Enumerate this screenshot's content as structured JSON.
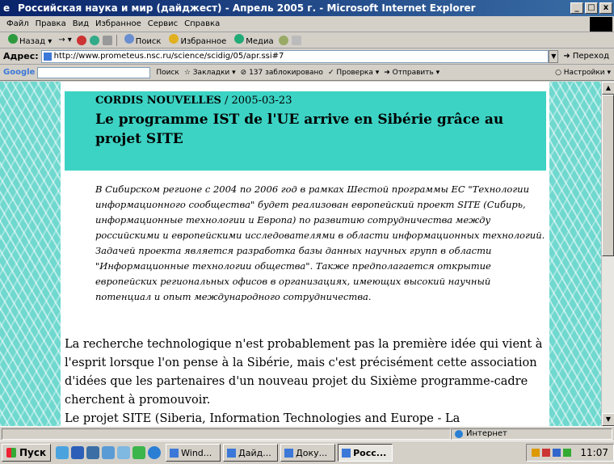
{
  "window": {
    "title": "Российская наука и мир (дайджест) - Апрель 2005 г. - Microsoft Internet Explorer",
    "min_label": "_",
    "max_label": "□",
    "close_label": "x"
  },
  "menu": [
    "Файл",
    "Правка",
    "Вид",
    "Избранное",
    "Сервис",
    "Справка"
  ],
  "toolbar": {
    "back": "Назад",
    "search": "Поиск",
    "favorites": "Избранное",
    "media": "Медиа"
  },
  "address": {
    "label": "Адрес:",
    "url": "http://www.prometeus.nsc.ru/science/scidig/05/apr.ssi#7",
    "go": "Переход"
  },
  "google": {
    "logo": "Google",
    "search": "Поиск",
    "bookmarks": "Закладки",
    "blocked": "137 заблокировано",
    "check": "Проверка",
    "send": "Отправить",
    "settings": "Настройки"
  },
  "article": {
    "source": "CORDIS NOUVELLES",
    "date": " / 2005-03-23",
    "headline": "Le programme IST de l'UE arrive en Sibérie grâce au projet SITE",
    "abstract": "В Сибирском регионе с 2004 по 2006 год в рамках Шестой программы ЕС \"Технологии информационного сообщества\" будет реализован европейский проект SITE (Сибирь, информационные технологии и Европа) по развитию сотрудничества между российскими и европейскими исследователями в области информационных технологий. Задачей проекта является разработка базы данных научных групп в области \"Информационные технологии общества\". Также предполагается открытие европейских региональных офисов в организациях, имеющих высокий научный потенциал и опыт международного сотрудничества.",
    "body": "La recherche technologique n'est probablement pas la première idée qui vient à l'esprit lorsque l'on pense à la Sibérie, mais c'est précisément cette association d'idées que les partenaires d'un nouveau projet du Sixième programme-cadre cherchent à promouvoir.",
    "body_cut": "Le projet SITE (Siberia, Information Technologies and Europe - La"
  },
  "status": {
    "zone": "Интернет"
  },
  "taskbar": {
    "start": "Пуск",
    "tasks": [
      "Wind...",
      "Дайд...",
      "Доку...",
      "Росс..."
    ],
    "clock": "11:07"
  },
  "colors": {
    "header_band": "#3cd3c4",
    "background_tile": "#6fd8cf",
    "titlebar": "#0a246a"
  }
}
